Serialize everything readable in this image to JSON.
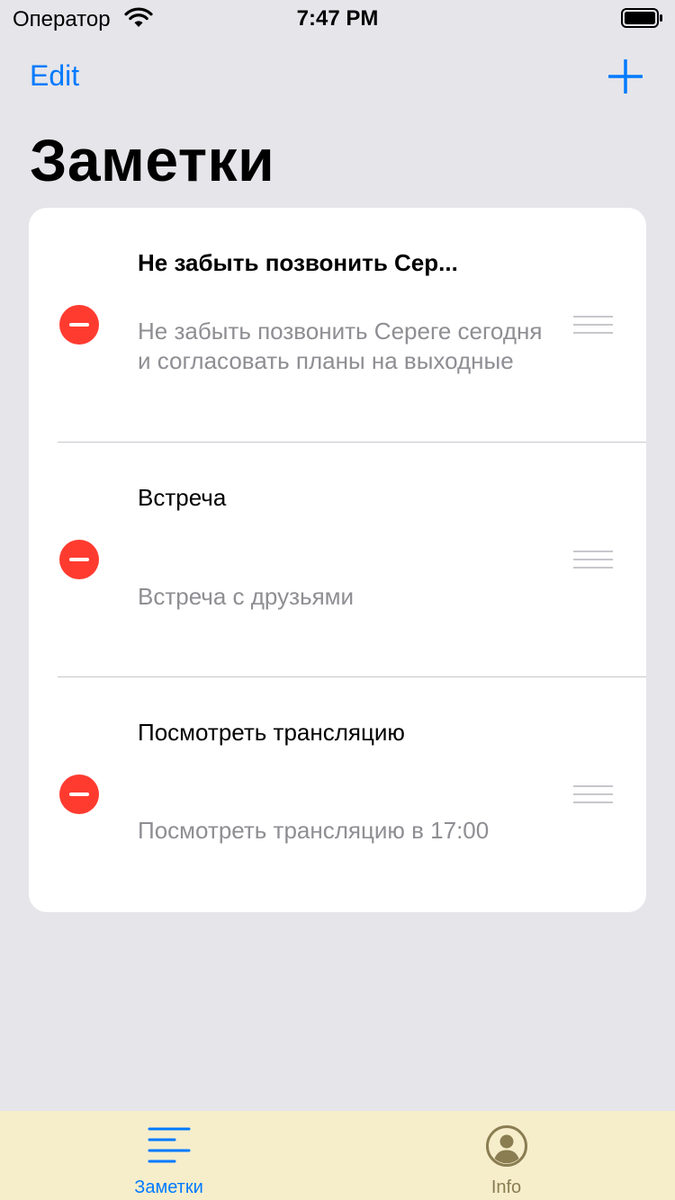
{
  "status_bar": {
    "carrier": "Оператор",
    "time": "7:47 PM"
  },
  "nav": {
    "edit_label": "Edit",
    "add_icon": "plus-icon",
    "title": "Заметки"
  },
  "notes": [
    {
      "title": "Не забыть позвонить Сер...",
      "body": "Не забыть позвонить Сереге сегодня и согласовать планы на выходные",
      "title_bold": true
    },
    {
      "title": "Встреча",
      "body": "Встреча с друзьями",
      "title_bold": false
    },
    {
      "title": "Посмотреть трансляцию",
      "body": "Посмотреть трансляцию в 17:00",
      "title_bold": false
    }
  ],
  "tab_bar": {
    "tabs": [
      {
        "label": "Заметки",
        "icon": "list-icon",
        "selected": true
      },
      {
        "label": "Info",
        "icon": "person-circle-icon",
        "selected": false
      }
    ]
  },
  "colors": {
    "accent": "#007aff",
    "delete": "#ff3b30",
    "tab_bar_bg": "#f6edcb",
    "tab_inactive": "#8a7d52",
    "background": "#e5e5ea"
  }
}
